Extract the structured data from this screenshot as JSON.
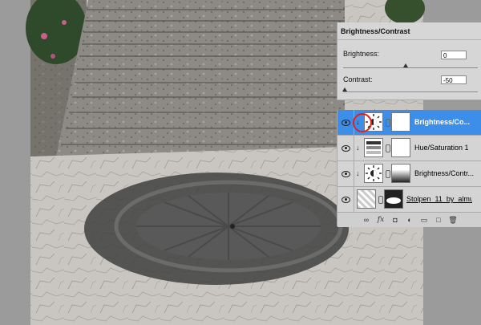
{
  "brightness_contrast": {
    "title": "Brightness/Contrast",
    "brightness_label": "Brightness:",
    "brightness_value": "0",
    "contrast_label": "Contrast:",
    "contrast_value": "-50"
  },
  "layers": [
    {
      "name": "Brightness/Co...",
      "type": "brightness",
      "selected": true
    },
    {
      "name": "Hue/Saturation 1",
      "type": "hue",
      "selected": false
    },
    {
      "name": "Brightness/Contr...",
      "type": "brightness",
      "selected": false
    },
    {
      "name": "Stolpen_11_by_almud...",
      "type": "image",
      "selected": false
    }
  ],
  "colors": {
    "selected_row": "#3d8ee8",
    "highlight_circle": "#e0201c"
  }
}
